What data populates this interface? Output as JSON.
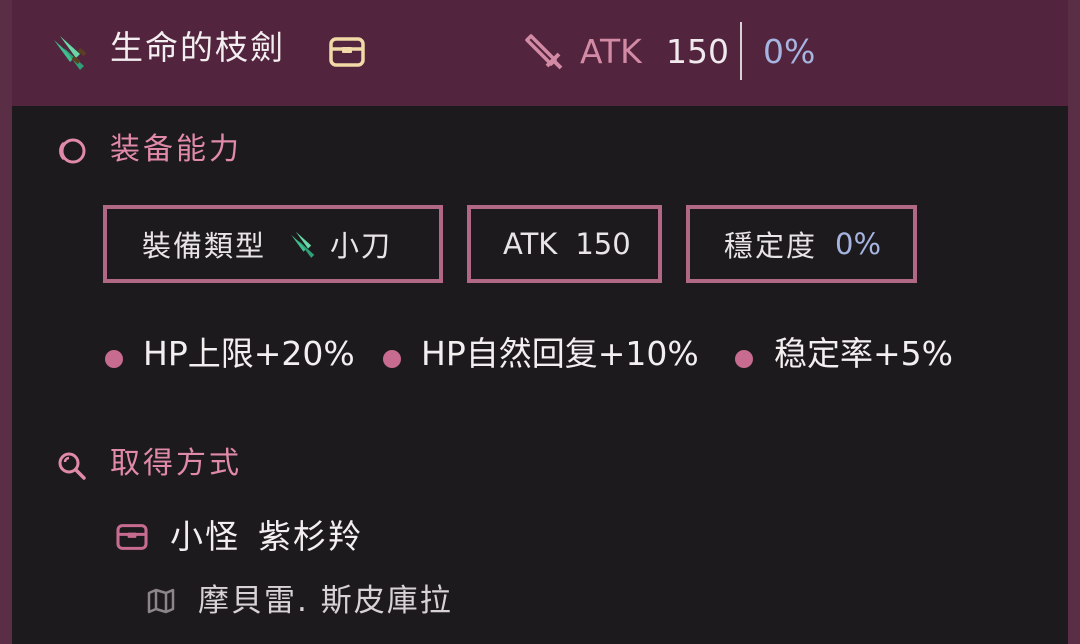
{
  "header": {
    "item_icon": "green-blade-icon",
    "title": "生命的枝劍",
    "drop_icon": "chest-icon",
    "stat_icon": "sword-icon",
    "atk_label": "ATK",
    "atk_value": "150",
    "stability_value": "0%"
  },
  "equip_section": {
    "icon": "ring-icon",
    "title": "装备能力",
    "type_label": "裝備類型",
    "type_icon": "green-blade-icon",
    "type_value": "小刀",
    "atk_label": "ATK",
    "atk_value": "150",
    "stability_label": "穩定度",
    "stability_value": "0%",
    "bonuses": [
      "HP上限+20%",
      "HP自然回复+10%",
      "稳定率+5%"
    ]
  },
  "obtain_section": {
    "icon": "search-icon",
    "title": "取得方式",
    "drop_icon": "chest-icon",
    "drop_type": "小怪",
    "monster_name": "紫杉羚",
    "map_icon": "map-icon",
    "location": "摩貝雷. 斯皮庫拉"
  },
  "colors": {
    "header_bg": "#52243d",
    "frame": "#5a2f45",
    "accent_pink": "#e08aa8",
    "box_border": "#b06885",
    "stability_blue": "#a5b4e0",
    "bullet": "#c86b90"
  }
}
